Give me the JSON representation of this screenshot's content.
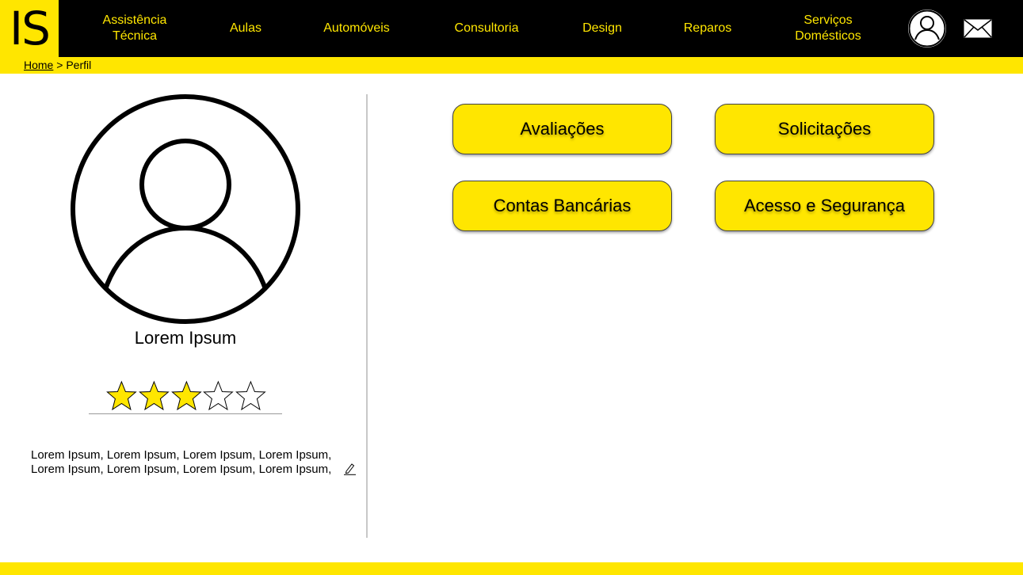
{
  "brand": {
    "logo_text": "IS",
    "accent": "#FFE600",
    "header_bg": "#000000"
  },
  "nav": {
    "items": [
      {
        "label": "Assistência\nTécnica"
      },
      {
        "label": "Aulas"
      },
      {
        "label": "Automóveis"
      },
      {
        "label": "Consultoria"
      },
      {
        "label": "Design"
      },
      {
        "label": "Reparos"
      },
      {
        "label": "Serviços\nDomésticos"
      }
    ],
    "icons": [
      "user-icon",
      "mail-icon"
    ]
  },
  "breadcrumb": {
    "home": "Home",
    "separator": " > ",
    "current": "Perfil"
  },
  "profile": {
    "name": "Lorem Ipsum",
    "rating": 3,
    "rating_max": 5,
    "bio_line1": "Lorem Ipsum, Lorem Ipsum, Lorem Ipsum, Lorem Ipsum,",
    "bio_line2": "Lorem Ipsum, Lorem Ipsum, Lorem Ipsum, Lorem Ipsum,"
  },
  "actions": {
    "reviews": "Avaliações",
    "requests": "Solicitações",
    "bank_accounts": "Contas Bancárias",
    "access_security": "Acesso e Segurança"
  }
}
